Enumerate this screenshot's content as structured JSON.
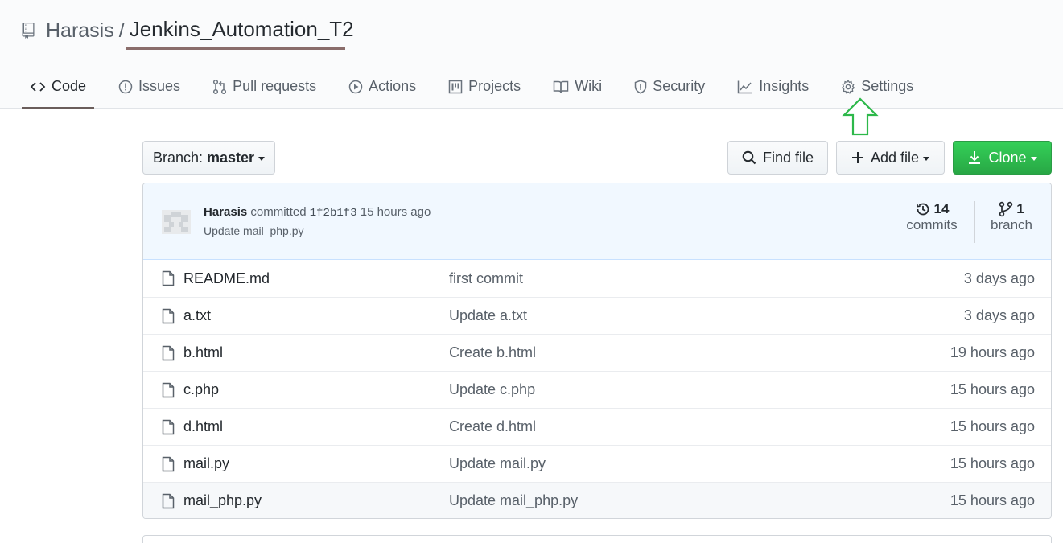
{
  "repo": {
    "owner": "Harasis",
    "separator": "/",
    "name": "Jenkins_Automation_T2"
  },
  "tabs": [
    {
      "label": "Code",
      "icon": "code-icon",
      "selected": true
    },
    {
      "label": "Issues",
      "icon": "issue-icon"
    },
    {
      "label": "Pull requests",
      "icon": "pull-request-icon"
    },
    {
      "label": "Actions",
      "icon": "play-icon"
    },
    {
      "label": "Projects",
      "icon": "project-icon"
    },
    {
      "label": "Wiki",
      "icon": "book-icon"
    },
    {
      "label": "Security",
      "icon": "shield-icon"
    },
    {
      "label": "Insights",
      "icon": "graph-icon"
    },
    {
      "label": "Settings",
      "icon": "gear-icon"
    }
  ],
  "toolbar": {
    "branch_prefix": "Branch:",
    "branch_name": "master",
    "find_file": "Find file",
    "add_file": "Add file",
    "clone": "Clone"
  },
  "commit": {
    "author": "Harasis",
    "verb": "committed",
    "sha": "1f2b1f3",
    "time": "15 hours ago",
    "message": "Update mail_php.py",
    "commits_count": "14",
    "commits_label": "commits",
    "branch_count": "1",
    "branch_label": "branch"
  },
  "files": [
    {
      "name": "README.md",
      "message": "first commit",
      "age": "3 days ago"
    },
    {
      "name": "a.txt",
      "message": "Update a.txt",
      "age": "3 days ago"
    },
    {
      "name": "b.html",
      "message": "Create b.html",
      "age": "19 hours ago"
    },
    {
      "name": "c.php",
      "message": "Update c.php",
      "age": "15 hours ago"
    },
    {
      "name": "d.html",
      "message": "Create d.html",
      "age": "15 hours ago"
    },
    {
      "name": "mail.py",
      "message": "Update mail.py",
      "age": "15 hours ago"
    },
    {
      "name": "mail_php.py",
      "message": "Update mail_php.py",
      "age": "15 hours ago"
    }
  ],
  "colors": {
    "clone_button": "#2ea44f",
    "annotation_arrow": "#2db84a",
    "commit_bar": "#f1f8ff"
  }
}
